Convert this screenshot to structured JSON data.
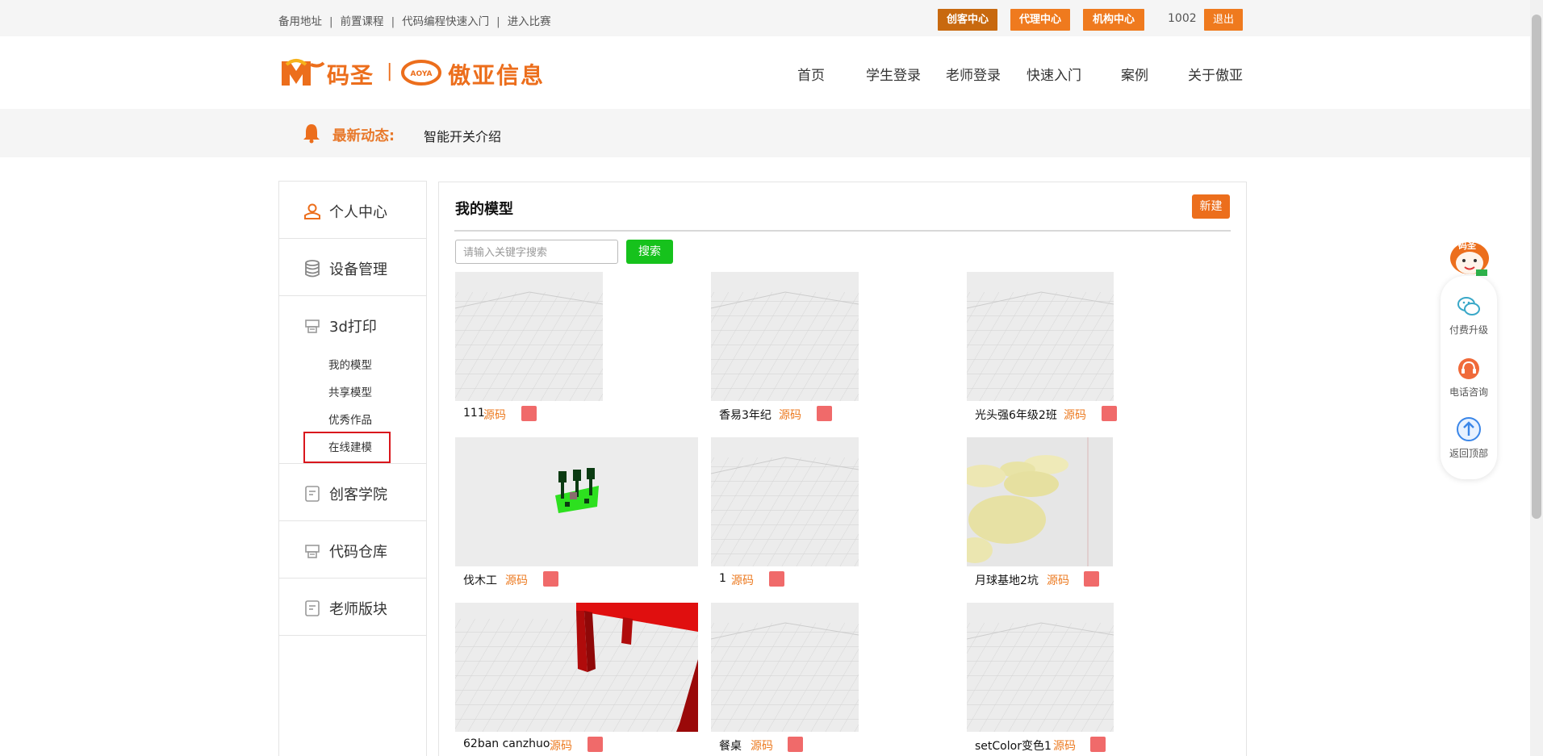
{
  "topbar": {
    "links": [
      "备用地址",
      "前置课程",
      "代码编程快速入门",
      "进入比赛"
    ],
    "separator": "|",
    "buttons": [
      {
        "label": "创客中心",
        "color": "#c8690f"
      },
      {
        "label": "代理中心",
        "color": "#ef7a1e"
      },
      {
        "label": "机构中心",
        "color": "#ef7a1e"
      }
    ],
    "user_id": "1002",
    "logout_label": "退出",
    "logout_color": "#ef7a1e"
  },
  "header": {
    "logo_left_text": "码圣",
    "logo_divider": "|",
    "logo_right_text": "傲亚信息",
    "nav": [
      "首页",
      "学生登录",
      "老师登录",
      "快速入门",
      "案例",
      "关于傲亚"
    ]
  },
  "news": {
    "label": "最新动态:",
    "text": "智能开关介绍"
  },
  "sidebar": {
    "items": [
      {
        "label": "个人中心",
        "icon": "user-icon"
      },
      {
        "label": "设备管理",
        "icon": "database-icon"
      },
      {
        "label": "3d打印",
        "icon": "printer-icon"
      },
      {
        "label": "创客学院",
        "icon": "document-icon"
      },
      {
        "label": "代码仓库",
        "icon": "printer-icon"
      },
      {
        "label": "老师版块",
        "icon": "document-icon"
      }
    ],
    "subitems": [
      "我的模型",
      "共享模型",
      "优秀作品",
      "在线建模"
    ]
  },
  "main": {
    "title": "我的模型",
    "new_label": "新建",
    "search_placeholder": "请输入关键字搜索",
    "search_label": "搜索",
    "source_label": "源码",
    "models": [
      {
        "name": "111"
      },
      {
        "name": "香易3年纪"
      },
      {
        "name": "光头强6年级2班"
      },
      {
        "name": "伐木工"
      },
      {
        "name": "1"
      },
      {
        "name": "月球基地2坑"
      },
      {
        "name": "62ban canzhuo"
      },
      {
        "name": "餐桌"
      },
      {
        "name": "setColor变色1"
      }
    ]
  },
  "float": {
    "badge": "码圣",
    "items": [
      "付费升级",
      "电话咨询",
      "返回顶部"
    ]
  },
  "colors": {
    "brand_orange": "#ec6e1c",
    "search_green": "#16c21c",
    "delete_red": "#f06a6a",
    "highlight_red": "#d9161c"
  }
}
